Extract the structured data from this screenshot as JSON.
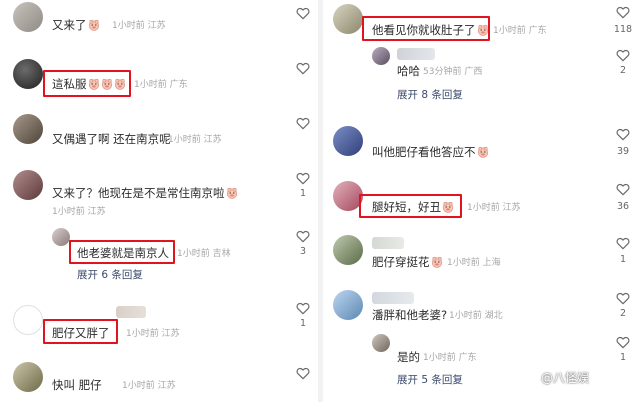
{
  "left": {
    "comments": [
      {
        "text": "又来了",
        "emoji_count": 1,
        "meta": "1小时前 江苏",
        "likes": ""
      },
      {
        "text": "這私服",
        "emoji_count": 3,
        "meta": "1小时前 广东",
        "likes": ""
      },
      {
        "text": "又偶遇了啊 还在南京呢",
        "emoji_count": 0,
        "meta": "1小时前 江苏",
        "likes": ""
      },
      {
        "text": "又来了？他现在是不是常住南京啦",
        "emoji_count": 1,
        "meta": "1小时前 江苏",
        "likes": "1"
      },
      {
        "text": "他老婆就是南京人",
        "emoji_count": 0,
        "meta": "1小时前 吉林",
        "likes": "3"
      },
      {
        "text": "肥仔又胖了",
        "emoji_count": 0,
        "meta": "1小时前 江苏",
        "likes": "1"
      },
      {
        "text": "快叫 肥仔",
        "emoji_count": 0,
        "meta": "1小时前 江苏",
        "likes": ""
      }
    ],
    "expand": "展开 6 条回复"
  },
  "right": {
    "comments": [
      {
        "text": "他看见你就收肚子了",
        "emoji_count": 1,
        "meta": "1小时前 广东",
        "likes": "118"
      },
      {
        "text": "哈哈",
        "emoji_count": 0,
        "meta": "53分钟前 广西",
        "likes": "2"
      },
      {
        "text": "叫他肥仔看他答应不",
        "emoji_count": 1,
        "meta": "",
        "likes": "39"
      },
      {
        "text": "腿好短，好丑",
        "emoji_count": 1,
        "meta": "1小时前 江苏",
        "likes": "36"
      },
      {
        "text": "肥仔穿挺花",
        "emoji_count": 1,
        "meta": "1小时前 上海",
        "likes": "1"
      },
      {
        "text": "潘胖和他老婆?",
        "emoji_count": 0,
        "meta": "1小时前 湖北",
        "likes": "2"
      },
      {
        "text": "是的",
        "emoji_count": 0,
        "meta": "1小时前 广东",
        "likes": "1"
      }
    ],
    "expand1": "展开 8 条回复",
    "expand2": "展开 5 条回复"
  },
  "watermark": "@八怪娱",
  "colors": {
    "highlight": "#e0141e",
    "expand": "#3a4a6b",
    "meta": "#a6a6a6"
  }
}
